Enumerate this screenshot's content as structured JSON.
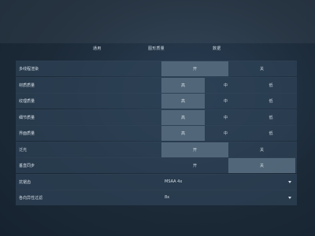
{
  "tabs": [
    "通用",
    "图形质量",
    "数据"
  ],
  "settings": [
    {
      "label": "多线程渲染",
      "options": [
        "开",
        "关"
      ],
      "selected": 0
    },
    {
      "label": "材质质量",
      "options": [
        "高",
        "中",
        "低"
      ],
      "selected": 0
    },
    {
      "label": "纹理质量",
      "options": [
        "高",
        "中",
        "低"
      ],
      "selected": 0
    },
    {
      "label": "细节质量",
      "options": [
        "高",
        "中",
        "低"
      ],
      "selected": 0
    },
    {
      "label": "界面质量",
      "options": [
        "高",
        "中",
        "低"
      ],
      "selected": 0
    },
    {
      "label": "泛光",
      "options": [
        "开",
        "关"
      ],
      "selected": 0
    },
    {
      "label": "垂直同步",
      "options": [
        "开",
        "关"
      ],
      "selected": 1
    }
  ],
  "dropdowns": [
    {
      "label": "抗锯齿",
      "value": "MSAA 4x"
    },
    {
      "label": "各向异性过滤",
      "value": "8x"
    }
  ]
}
